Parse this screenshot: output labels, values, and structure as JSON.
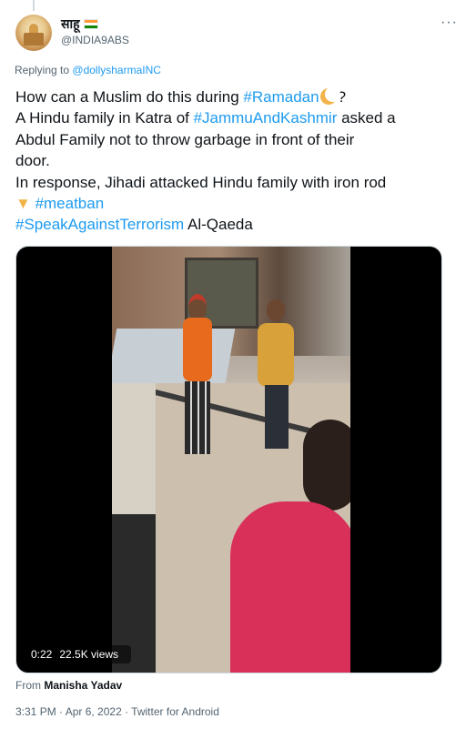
{
  "header": {
    "display_name": "साहू",
    "handle": "@INDIA9ABS",
    "more_label": "···"
  },
  "reply": {
    "prefix": "Replying to",
    "to": "@dollysharmaINC"
  },
  "tweet": {
    "line1_a": "How can a Muslim do this during ",
    "line1_hashtag": "#Ramadan",
    "line1_b": "?",
    "line2_a": "A Hindu family in Katra of ",
    "line2_hashtag": "#JammuAndKashmir",
    "line2_b": " asked a",
    "line3": "Abdul Family not to throw garbage in front of their",
    "line4": "door.",
    "line5": "In response, Jihadi attacked Hindu family with iron rod",
    "line6_hashtag": "#meatban",
    "line7_hashtag": "#SpeakAgainstTerrorism",
    "line7_b": " Al-Qaeda"
  },
  "media": {
    "duration": "0:22",
    "views": "22.5K views"
  },
  "source": {
    "prefix": "From",
    "name": "Manisha Yadav"
  },
  "meta": {
    "timestamp": "3:31 PM · Apr 6, 2022 · Twitter for Android"
  },
  "icons": [
    "flag-india-icon",
    "crescent-moon-icon",
    "pointing-down-icon",
    "more-icon"
  ],
  "colors": {
    "link": "#1d9bf0",
    "text": "#0f1419",
    "muted": "#536471"
  }
}
